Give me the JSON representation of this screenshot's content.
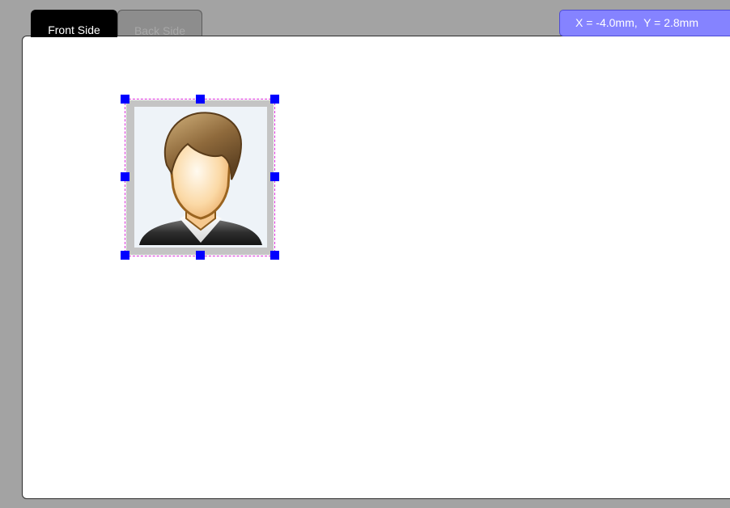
{
  "tabs": {
    "front": {
      "label": "Front Side",
      "active": true
    },
    "back": {
      "label": "Back Side",
      "active": false
    }
  },
  "coordinates": {
    "text": "X = -4.0mm,  Y = 2.8mm"
  },
  "photo": {
    "icon": "person-avatar-icon",
    "selected": true
  },
  "colors": {
    "background": "#a3a3a3",
    "active_tab": "#000000",
    "inactive_tab": "#8d8d8d",
    "coordinate_badge": "#8583ff",
    "selection_handle": "#0000ff",
    "selection_outline": "#d82ad8"
  }
}
